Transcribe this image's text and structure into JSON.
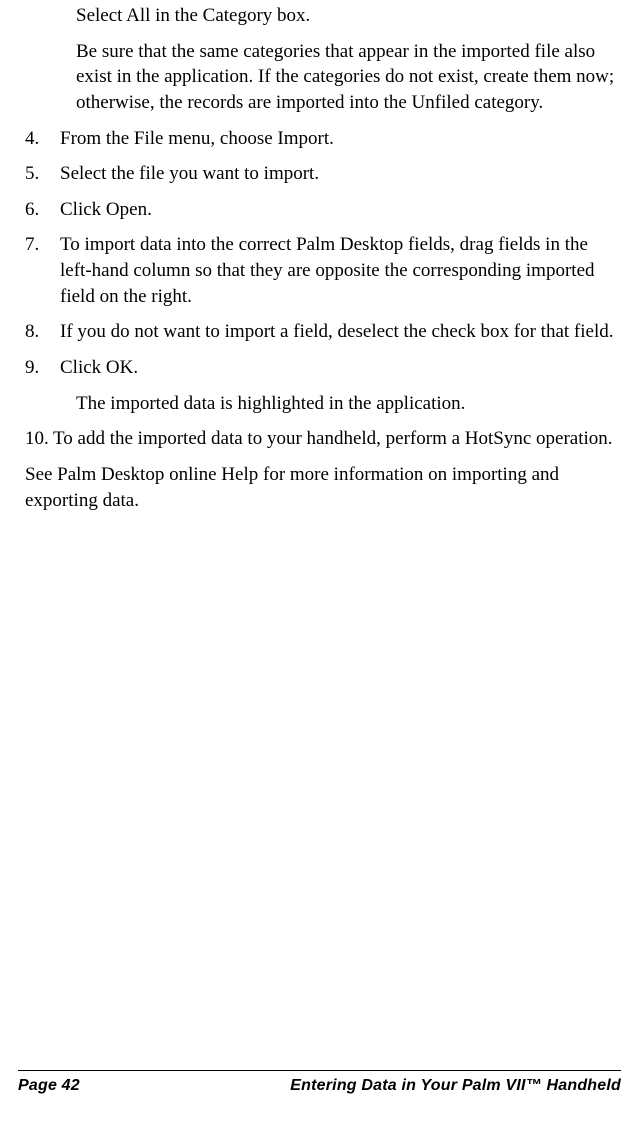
{
  "body": {
    "continued_note_1": "Select All in the Category box.",
    "continued_note_2": "Be sure that the same categories that appear in the imported file also exist in the application. If the categories do not exist, create them now; otherwise, the records are imported into the Unfiled category.",
    "steps": [
      {
        "num": "4.",
        "text": "From the File menu, choose Import."
      },
      {
        "num": "5.",
        "text": "Select the file you want to import."
      },
      {
        "num": "6.",
        "text": "Click Open."
      },
      {
        "num": "7.",
        "text": "To import data into the correct Palm Desktop fields, drag fields in the left-hand column so that they are opposite the corresponding imported field on the right."
      },
      {
        "num": "8.",
        "text": "If you do not want to import a field, deselect the check box for that field."
      },
      {
        "num": "9.",
        "text": "Click OK."
      }
    ],
    "step9_sub": "The imported data is highlighted in the application.",
    "step10_num": "10.",
    "step10_text": "To add the imported data to your handheld, perform a HotSync operation.",
    "closing": "See Palm Desktop online Help for more information on importing and exporting data."
  },
  "footer": {
    "page_label": "Page 42",
    "chapter": "Entering Data in Your Palm VII™ Handheld"
  }
}
